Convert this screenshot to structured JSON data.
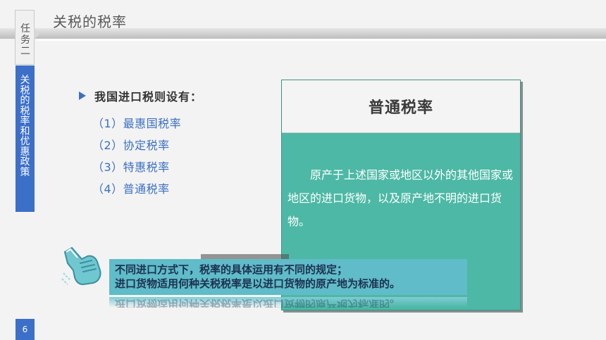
{
  "header": {
    "title": "关税的税率"
  },
  "task_tab": {
    "label": "任务二"
  },
  "sidebar": {
    "section_title": "关税的税率和优惠政策"
  },
  "content": {
    "intro": "我国进口税则设有：",
    "rates": [
      "（1）最惠国税率",
      "（2）协定税率",
      "（3）特惠税率",
      "（4）普通税率"
    ]
  },
  "card": {
    "title": "普通税率",
    "body": "原产于上述国家或地区以外的其他国家或地区的进口货物，以及原产地不明的进口货物。"
  },
  "note": {
    "line1": "不同进口方式下，税率的具体运用有不同的规定；",
    "line2": "进口货物适用何种关税税率是以进口货物的原产地为标准的。"
  },
  "footer": {
    "page_number": "6"
  },
  "colors": {
    "accent_blue": "#3c6fc8",
    "card_teal": "#4db8a5",
    "note_cyan": "#5fbcc8"
  },
  "icons": {
    "bullet": "arrow-bullet-icon",
    "note": "pointing-hand-icon"
  }
}
